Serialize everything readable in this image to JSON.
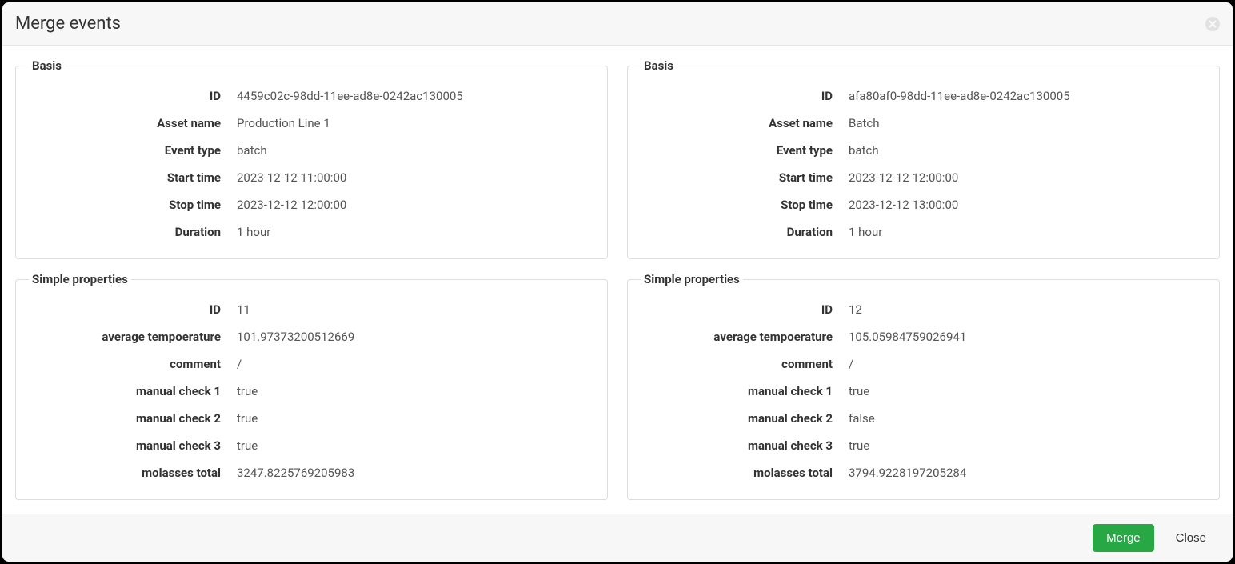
{
  "modal": {
    "title": "Merge events",
    "merge_label": "Merge",
    "close_label": "Close"
  },
  "labels": {
    "basis_legend": "Basis",
    "simple_legend": "Simple properties",
    "id": "ID",
    "asset_name": "Asset name",
    "event_type": "Event type",
    "start_time": "Start time",
    "stop_time": "Stop time",
    "duration": "Duration",
    "avg_temp": "average tempoerature",
    "comment": "comment",
    "manual_check_1": "manual check 1",
    "manual_check_2": "manual check 2",
    "manual_check_3": "manual check 3",
    "molasses_total": "molasses total"
  },
  "left": {
    "basis": {
      "id": "4459c02c-98dd-11ee-ad8e-0242ac130005",
      "asset_name": "Production Line 1",
      "event_type": "batch",
      "start_time": "2023-12-12 11:00:00",
      "stop_time": "2023-12-12 12:00:00",
      "duration": "1 hour"
    },
    "simple": {
      "id": "11",
      "avg_temp": "101.97373200512669",
      "comment": "/",
      "manual_check_1": "true",
      "manual_check_2": "true",
      "manual_check_3": "true",
      "molasses_total": "3247.8225769205983"
    }
  },
  "right": {
    "basis": {
      "id": "afa80af0-98dd-11ee-ad8e-0242ac130005",
      "asset_name": "Batch",
      "event_type": "batch",
      "start_time": "2023-12-12 12:00:00",
      "stop_time": "2023-12-12 13:00:00",
      "duration": "1 hour"
    },
    "simple": {
      "id": "12",
      "avg_temp": "105.05984759026941",
      "comment": "/",
      "manual_check_1": "true",
      "manual_check_2": "false",
      "manual_check_3": "true",
      "molasses_total": "3794.9228197205284"
    }
  }
}
